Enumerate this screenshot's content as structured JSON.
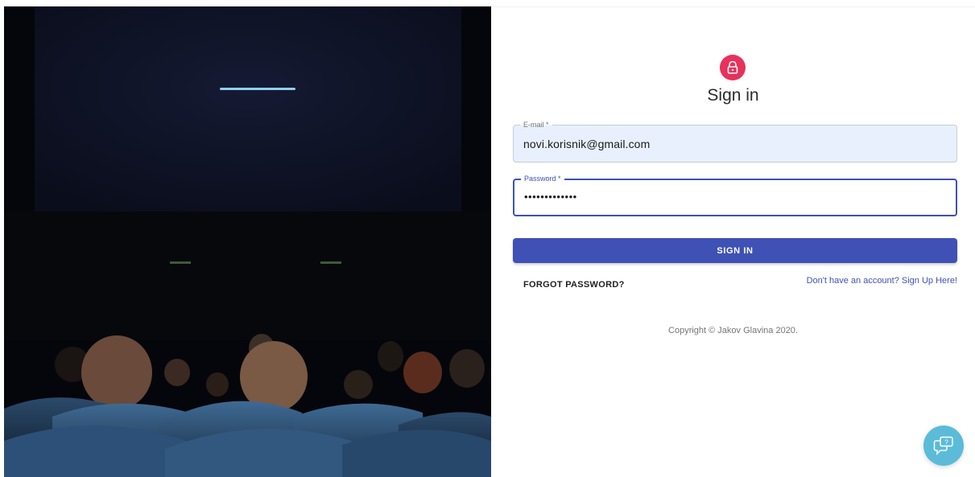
{
  "hero": {
    "alt": "cinema audience facing a screen",
    "icon": "cinema-photo"
  },
  "header": {
    "lock_icon": "lock-icon",
    "accent": "#e8315b",
    "title": "Sign in"
  },
  "form": {
    "email": {
      "label": "E-mail *",
      "value": "novi.korisnik@gmail.com"
    },
    "password": {
      "label": "Password *",
      "value": "•••••••••••••"
    },
    "submit_label": "SIGN IN",
    "primary_color": "#3f51b5"
  },
  "links": {
    "forgot": "FORGOT PASSWORD?",
    "signup": "Don't have an account? Sign Up Here!"
  },
  "footer": {
    "copyright": "Copyright © Jakov Glavina 2020."
  },
  "chat": {
    "icon": "chat-help-icon",
    "color": "#5bbbd9"
  }
}
